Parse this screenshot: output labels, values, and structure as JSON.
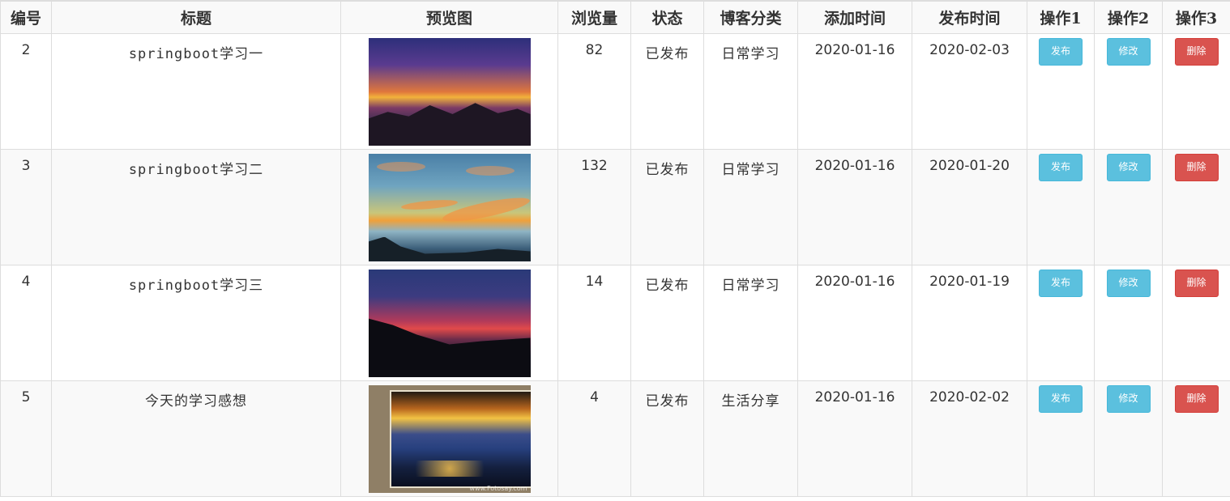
{
  "table": {
    "headers": {
      "id": "编号",
      "title": "标题",
      "preview": "预览图",
      "views": "浏览量",
      "status": "状态",
      "category": "博客分类",
      "added": "添加时间",
      "published": "发布时间",
      "op1": "操作1",
      "op2": "操作2",
      "op3": "操作3"
    },
    "rows": [
      {
        "id": "2",
        "title": "springboot学习一",
        "views": "82",
        "status": "已发布",
        "category": "日常学习",
        "added": "2020-01-16",
        "published": "2020-02-03",
        "publish_btn": "发布",
        "edit_btn": "修改",
        "delete_btn": "删除",
        "preview_icon": "sunset-image-1"
      },
      {
        "id": "3",
        "title": "springboot学习二",
        "views": "132",
        "status": "已发布",
        "category": "日常学习",
        "added": "2020-01-16",
        "published": "2020-01-20",
        "publish_btn": "发布",
        "edit_btn": "修改",
        "delete_btn": "删除",
        "preview_icon": "sunset-image-2"
      },
      {
        "id": "4",
        "title": "springboot学习三",
        "views": "14",
        "status": "已发布",
        "category": "日常学习",
        "added": "2020-01-16",
        "published": "2020-01-19",
        "publish_btn": "发布",
        "edit_btn": "修改",
        "delete_btn": "删除",
        "preview_icon": "sunset-image-3"
      },
      {
        "id": "5",
        "title": "今天的学习感想",
        "views": "4",
        "status": "已发布",
        "category": "生活分享",
        "added": "2020-01-16",
        "published": "2020-02-02",
        "publish_btn": "发布",
        "edit_btn": "修改",
        "delete_btn": "删除",
        "preview_icon": "sunset-image-4",
        "watermark": "www.Fotosay.com"
      }
    ]
  },
  "colors": {
    "info_button": "#5bc0de",
    "danger_button": "#d9534f",
    "border": "#dddddd",
    "stripe": "#f9f9f9"
  }
}
